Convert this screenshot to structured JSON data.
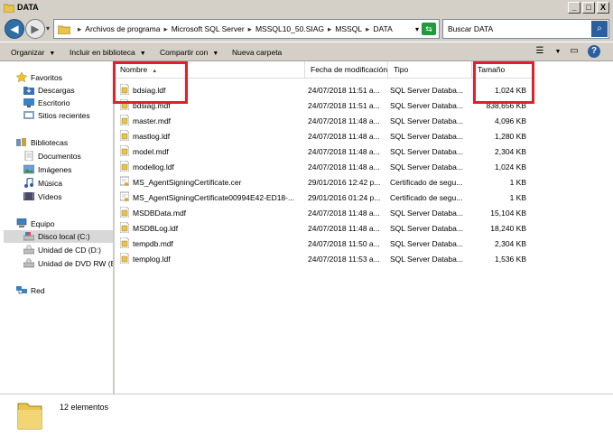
{
  "window": {
    "title": "DATA"
  },
  "titlebar_buttons": {
    "minimize": "_",
    "maximize": "□",
    "close": "X"
  },
  "address": {
    "crumbs": [
      "Archivos de programa",
      "Microsoft SQL Server",
      "MSSQL10_50.SIAG",
      "MSSQL",
      "DATA"
    ],
    "separator": "▸"
  },
  "search": {
    "placeholder": "Buscar DATA"
  },
  "toolbar": {
    "organize": "Organizar",
    "include": "Incluir en biblioteca",
    "share": "Compartir con",
    "new_folder": "Nueva carpeta"
  },
  "nav": {
    "favorites": "Favoritos",
    "downloads": "Descargas",
    "desktop": "Escritorio",
    "recent": "Sitios recientes",
    "libraries": "Bibliotecas",
    "documents": "Documentos",
    "images": "Imágenes",
    "music": "Música",
    "videos": "Vídeos",
    "computer": "Equipo",
    "local_disk": "Disco local (C:)",
    "cd_drive": "Unidad de CD (D:)",
    "dvd_drive": "Unidad de DVD RW (E:",
    "network": "Red"
  },
  "columns": {
    "name": "Nombre",
    "date": "Fecha de modificación",
    "type": "Tipo",
    "size": "Tamaño"
  },
  "files": [
    {
      "name": "bdsiag.ldf",
      "date": "24/07/2018 11:51 a...",
      "type": "SQL Server Databa...",
      "size": "1,024 KB",
      "icon": "db-file-icon"
    },
    {
      "name": "bdsiag.mdf",
      "date": "24/07/2018 11:51 a...",
      "type": "SQL Server Databa...",
      "size": "838,656 KB",
      "icon": "db-file-icon"
    },
    {
      "name": "master.mdf",
      "date": "24/07/2018 11:48 a...",
      "type": "SQL Server Databa...",
      "size": "4,096 KB",
      "icon": "db-file-icon"
    },
    {
      "name": "mastlog.ldf",
      "date": "24/07/2018 11:48 a...",
      "type": "SQL Server Databa...",
      "size": "1,280 KB",
      "icon": "db-file-icon"
    },
    {
      "name": "model.mdf",
      "date": "24/07/2018 11:48 a...",
      "type": "SQL Server Databa...",
      "size": "2,304 KB",
      "icon": "db-file-icon"
    },
    {
      "name": "modellog.ldf",
      "date": "24/07/2018 11:48 a...",
      "type": "SQL Server Databa...",
      "size": "1,024 KB",
      "icon": "db-file-icon"
    },
    {
      "name": "MS_AgentSigningCertificate.cer",
      "date": "29/01/2016 12:42 p...",
      "type": "Certificado de segu...",
      "size": "1 KB",
      "icon": "certificate-icon"
    },
    {
      "name": "MS_AgentSigningCertificate00994E42-ED18-...",
      "date": "29/01/2016 01:24 p...",
      "type": "Certificado de segu...",
      "size": "1 KB",
      "icon": "certificate-icon"
    },
    {
      "name": "MSDBData.mdf",
      "date": "24/07/2018 11:48 a...",
      "type": "SQL Server Databa...",
      "size": "15,104 KB",
      "icon": "db-file-icon"
    },
    {
      "name": "MSDBLog.ldf",
      "date": "24/07/2018 11:48 a...",
      "type": "SQL Server Databa...",
      "size": "18,240 KB",
      "icon": "db-file-icon"
    },
    {
      "name": "tempdb.mdf",
      "date": "24/07/2018 11:50 a...",
      "type": "SQL Server Databa...",
      "size": "2,304 KB",
      "icon": "db-file-icon"
    },
    {
      "name": "templog.ldf",
      "date": "24/07/2018 11:53 a...",
      "type": "SQL Server Databa...",
      "size": "1,536 KB",
      "icon": "db-file-icon"
    }
  ],
  "status": {
    "count": "12 elementos"
  },
  "colors": {
    "highlight": "#e0202a",
    "selection": "#d8d8d8"
  }
}
